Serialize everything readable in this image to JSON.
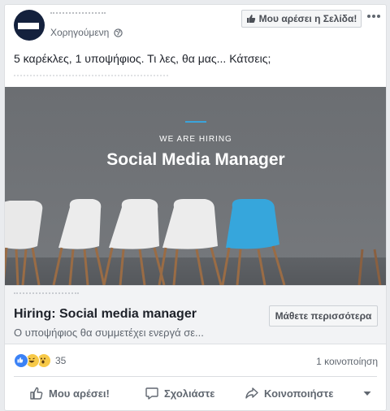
{
  "header": {
    "sponsored_label": "Χορηγούμενη",
    "like_page_label": "Μου αρέσει η Σελίδα!",
    "icons": [
      "globe-icon",
      "thumbs-up-icon",
      "more-dots-icon"
    ]
  },
  "post": {
    "text": "5 καρέκλες, 1 υποψήφιος. Τι λες, θα μας... Κάτσεις;"
  },
  "ad_image": {
    "eyebrow": "WE ARE HIRING",
    "headline": "Social Media Manager",
    "colors": {
      "background": "#6e7175",
      "chair_white": "#eeeeee",
      "chair_blue": "#36a6dc",
      "accent_line": "#3aa4dc"
    }
  },
  "link": {
    "title": "Hiring: Social media manager",
    "description": "Ο υποψήφιος θα συμμετέχει ενεργά σε...",
    "cta_label": "Μάθετε περισσότερα"
  },
  "engagement": {
    "reaction_count": "35",
    "shares": "1 κοινοποίηση",
    "reaction_icons": [
      "like-reaction-icon",
      "haha-reaction-icon",
      "wow-reaction-icon"
    ]
  },
  "actions": {
    "like": "Μου αρέσει!",
    "comment": "Σχολιάστε",
    "share": "Κοινοποιήστε"
  }
}
